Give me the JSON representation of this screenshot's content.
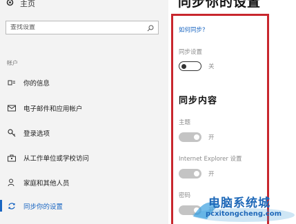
{
  "sidebar": {
    "home_label": "主页",
    "search": {
      "placeholder": "查找设置"
    },
    "section_header": "帐户",
    "items": [
      {
        "label": "你的信息",
        "icon": "person-card-icon"
      },
      {
        "label": "电子邮件和应用帐户",
        "icon": "mail-icon"
      },
      {
        "label": "登录选项",
        "icon": "key-icon"
      },
      {
        "label": "从工作单位或学校访问",
        "icon": "briefcase-icon"
      },
      {
        "label": "家庭和其他人员",
        "icon": "person-add-icon"
      },
      {
        "label": "同步你的设置",
        "icon": "sync-icon",
        "active": true
      }
    ]
  },
  "main": {
    "title": "同步你的设置",
    "help_link": "如何同步?",
    "sync_settings": {
      "label": "同步设置",
      "state": "关",
      "on": false
    },
    "content_heading": "同步内容",
    "options": [
      {
        "label": "主题",
        "state": "开",
        "on": true
      },
      {
        "label": "Internet Explorer 设置",
        "state": "开",
        "on": true
      },
      {
        "label": "密码",
        "state": "开",
        "on": true
      }
    ]
  },
  "watermark": {
    "text": "电脑系统城",
    "url": "pcxitongcheng.com"
  },
  "colors": {
    "accent": "#1a66c2",
    "highlight_border": "#c8262d",
    "watermark": "#1e68b8"
  }
}
